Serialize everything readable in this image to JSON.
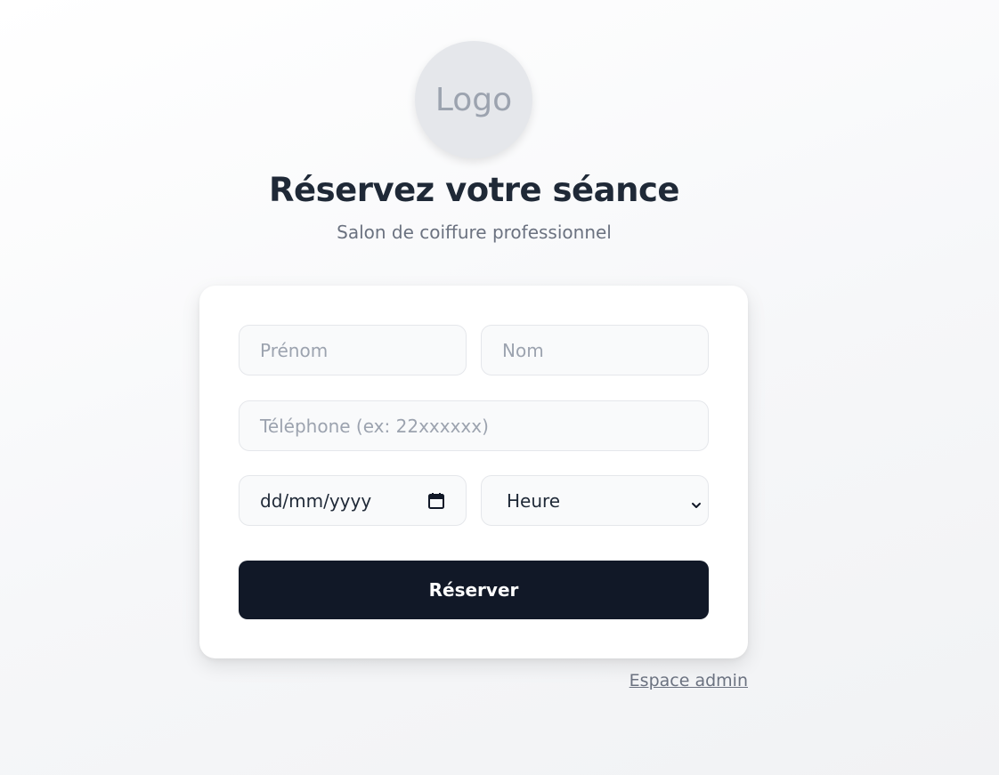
{
  "logo": {
    "text": "Logo"
  },
  "header": {
    "title": "Réservez votre séance",
    "subtitle": "Salon de coiffure professionnel"
  },
  "form": {
    "first_name": {
      "placeholder": "Prénom",
      "value": ""
    },
    "last_name": {
      "placeholder": "Nom",
      "value": ""
    },
    "phone": {
      "placeholder": "Téléphone (ex: 22xxxxxx)",
      "value": ""
    },
    "date": {
      "display": "dd/mm/yyyy",
      "icon": "calendar-icon"
    },
    "time": {
      "selected": "Heure",
      "icon": "chevron-down-icon"
    },
    "submit_label": "Réserver"
  },
  "footer": {
    "admin_link": "Espace admin"
  },
  "colors": {
    "primary_button": "#111827",
    "field_bg": "#f9fafb",
    "field_border": "#e5e7eb",
    "text_muted": "#6b7280",
    "placeholder": "#9ca3af"
  }
}
